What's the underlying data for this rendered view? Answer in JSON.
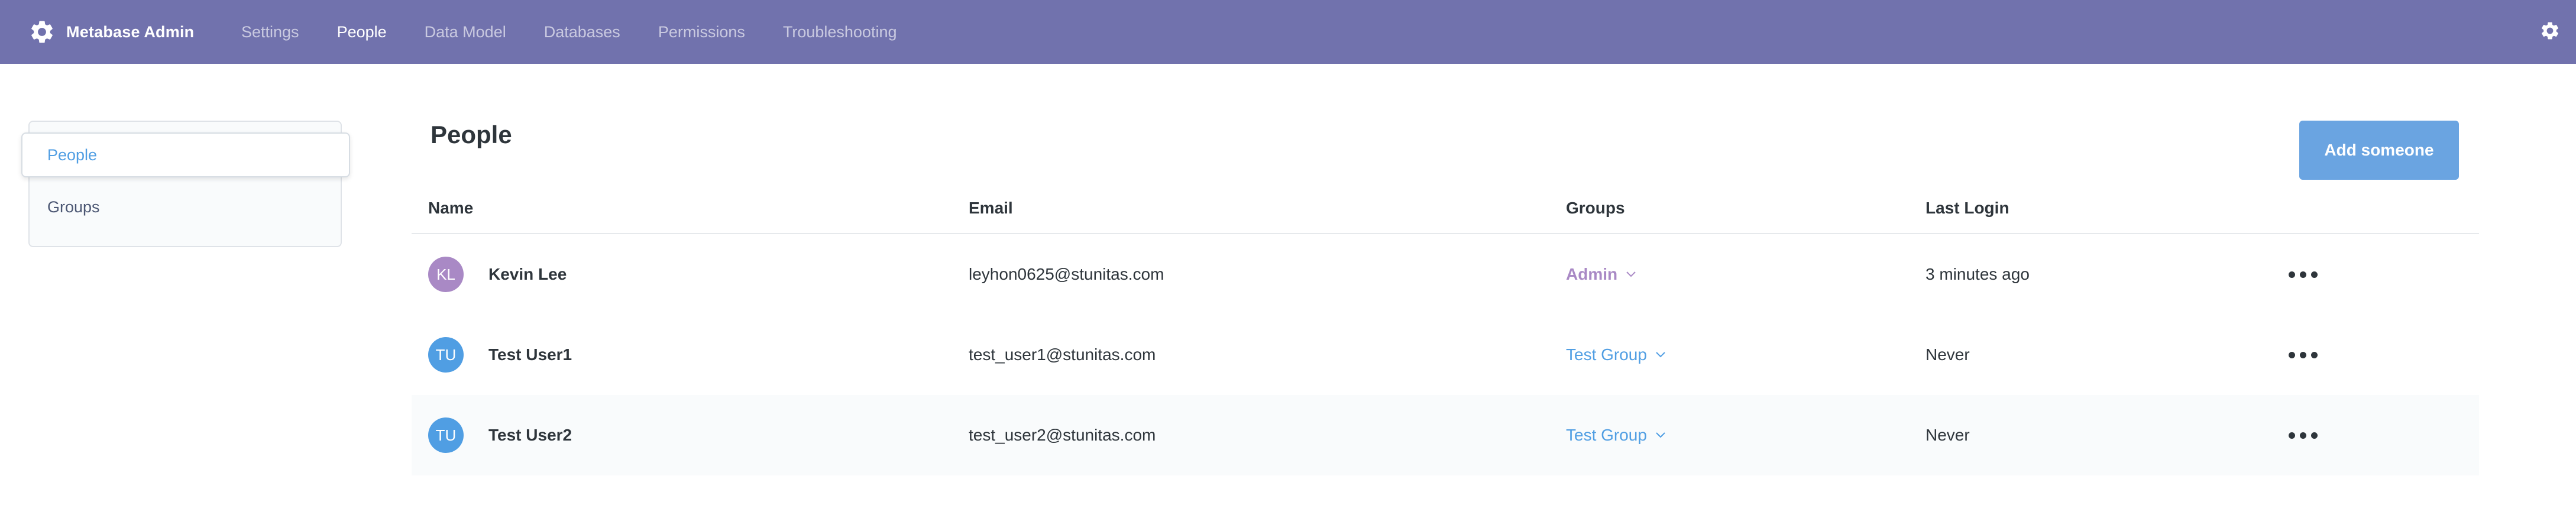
{
  "header": {
    "brand_title": "Metabase Admin",
    "brand_icon": "gear-icon",
    "nav": [
      {
        "label": "Settings",
        "active": false
      },
      {
        "label": "People",
        "active": true
      },
      {
        "label": "Data Model",
        "active": false
      },
      {
        "label": "Databases",
        "active": false
      },
      {
        "label": "Permissions",
        "active": false
      },
      {
        "label": "Troubleshooting",
        "active": false
      }
    ],
    "settings_icon": "gear-icon",
    "bar_color": "#7172ad"
  },
  "sidebar": {
    "items": [
      {
        "label": "People",
        "active": true
      },
      {
        "label": "Groups",
        "active": false
      }
    ]
  },
  "main": {
    "title": "People",
    "add_button_label": "Add someone",
    "columns": [
      "Name",
      "Email",
      "Groups",
      "Last Login"
    ],
    "rows": [
      {
        "initials": "KL",
        "avatar_color": "#a989c5",
        "name": "Kevin Lee",
        "email": "leyhon0625@stunitas.com",
        "group": "Admin",
        "group_color": "#a989c5",
        "last_login": "3 minutes ago"
      },
      {
        "initials": "TU",
        "avatar_color": "#509ee3",
        "name": "Test User1",
        "email": "test_user1@stunitas.com",
        "group": "Test Group",
        "group_color": "#509ee3",
        "last_login": "Never"
      },
      {
        "initials": "TU",
        "avatar_color": "#509ee3",
        "name": "Test User2",
        "email": "test_user2@stunitas.com",
        "group": "Test Group",
        "group_color": "#509ee3",
        "last_login": "Never"
      }
    ]
  },
  "colors": {
    "accent": "#509ee3",
    "button": "#6aa4e1"
  }
}
